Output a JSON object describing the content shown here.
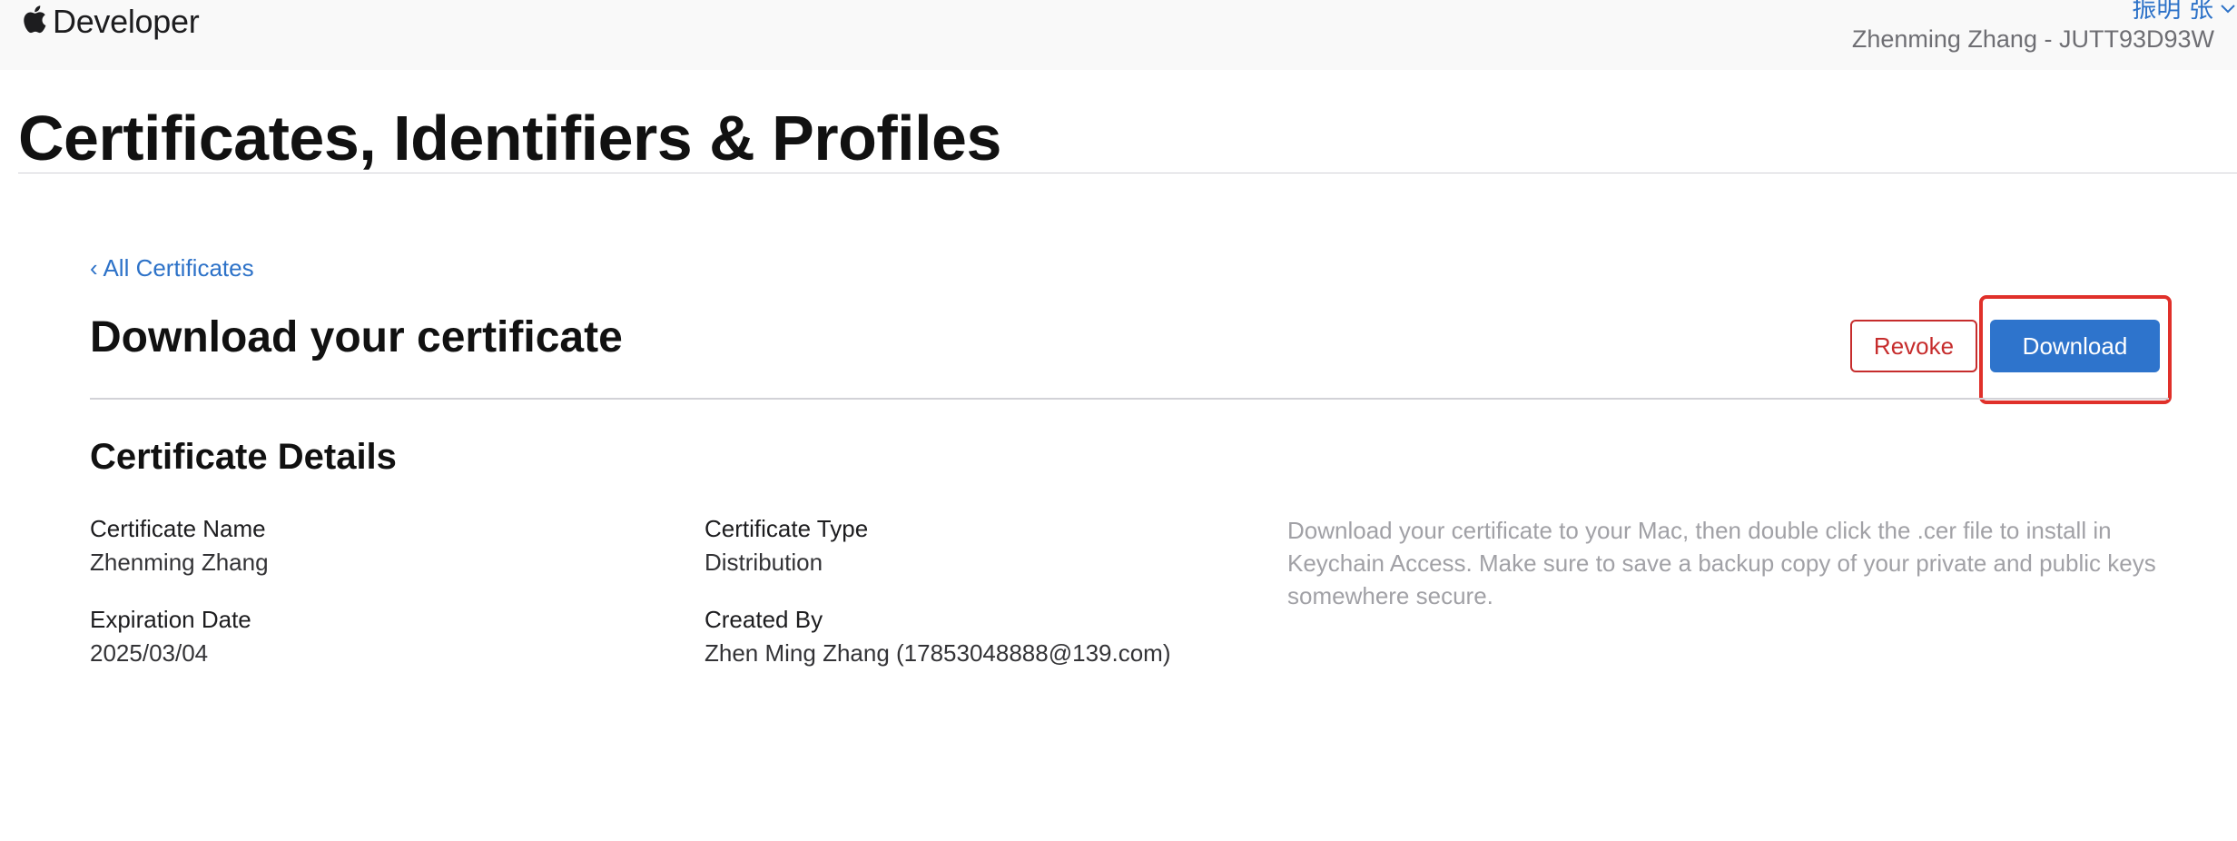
{
  "header": {
    "brand": "Developer",
    "user_name": "振明 张",
    "team": "Zhenming Zhang - JUTT93D93W"
  },
  "page": {
    "title": "Certificates, Identifiers & Profiles"
  },
  "nav": {
    "back_link": "‹ All Certificates"
  },
  "section": {
    "heading": "Download your certificate",
    "revoke_label": "Revoke",
    "download_label": "Download"
  },
  "details": {
    "heading": "Certificate Details",
    "certificate_name_label": "Certificate Name",
    "certificate_name_value": "Zhenming Zhang",
    "certificate_type_label": "Certificate Type",
    "certificate_type_value": "Distribution",
    "expiration_date_label": "Expiration Date",
    "expiration_date_value": "2025/03/04",
    "created_by_label": "Created By",
    "created_by_value": "Zhen Ming Zhang (17853048888@139.com)",
    "info": "Download your certificate to your Mac, then double click the .cer file to install in Keychain Access. Make sure to save a backup copy of your private and public keys somewhere secure."
  },
  "colors": {
    "link": "#2d72c8",
    "revoke": "#c62c2c",
    "download_bg": "#2e74cc",
    "highlight": "#e0302a"
  },
  "icons": {
    "brand": "apple-logo-icon",
    "user_menu": "chevron-down-icon"
  }
}
